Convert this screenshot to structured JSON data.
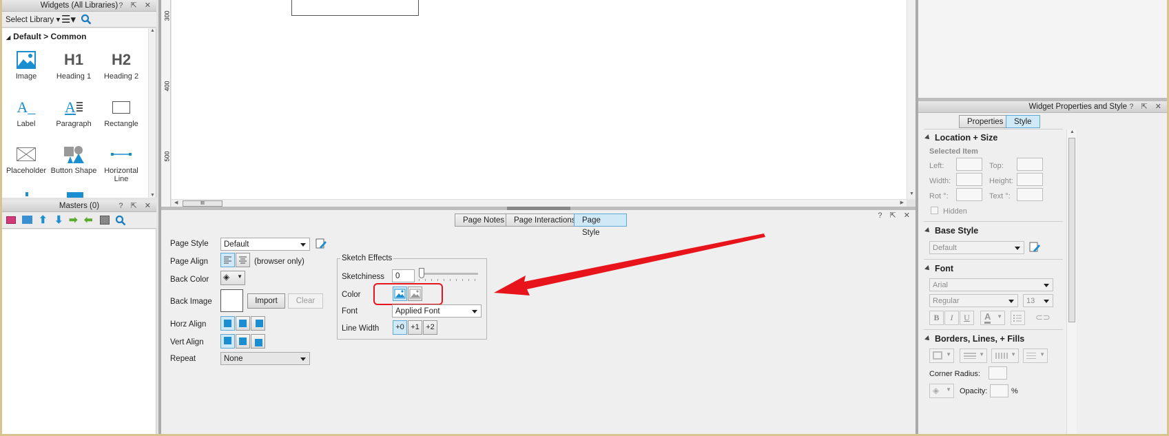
{
  "widgets_panel": {
    "title": "Widgets (All Libraries)",
    "select_library": "Select Library",
    "group": "Default > Common",
    "items": [
      {
        "label": "Image",
        "icon": "image-icon"
      },
      {
        "label": "Heading 1",
        "icon_text": "H1"
      },
      {
        "label": "Heading 2",
        "icon_text": "H2"
      },
      {
        "label": "Label",
        "icon_text": "A_"
      },
      {
        "label": "Paragraph",
        "icon_text": "A"
      },
      {
        "label": "Rectangle",
        "icon": "rectangle-icon"
      },
      {
        "label": "Placeholder",
        "icon": "placeholder-icon"
      },
      {
        "label": "Button Shape",
        "icon": "button-shape-icon"
      },
      {
        "label": "Horizontal Line",
        "icon": "horizontal-line-icon"
      }
    ]
  },
  "masters_panel": {
    "title": "Masters (0)"
  },
  "canvas": {
    "ruler_ticks": [
      "300",
      "400",
      "500"
    ],
    "scroll_thumb": "III"
  },
  "page_panel": {
    "tabs": [
      "Page Notes",
      "Page Interactions",
      "Page Style"
    ],
    "active_tab": "Page Style",
    "page_style_label": "Page Style",
    "page_style_value": "Default",
    "page_align_label": "Page Align",
    "browser_only": "(browser only)",
    "back_color_label": "Back Color",
    "back_image_label": "Back Image",
    "import_label": "Import",
    "clear_label": "Clear",
    "horz_align_label": "Horz Align",
    "vert_align_label": "Vert Align",
    "repeat_label": "Repeat",
    "repeat_value": "None",
    "sketch": {
      "title": "Sketch Effects",
      "sketchiness_label": "Sketchiness",
      "sketchiness_value": "0",
      "sketchiness_level": 0,
      "color_label": "Color",
      "font_label": "Font",
      "font_value": "Applied Font",
      "line_width_label": "Line Width",
      "line_widths": [
        "+0",
        "+1",
        "+2"
      ]
    }
  },
  "props_panel": {
    "title": "Widget Properties and Style",
    "tabs": [
      "Properties",
      "Style"
    ],
    "active_tab": "Style",
    "location_size": "Location + Size",
    "selected_item": "Selected Item",
    "left": "Left:",
    "top": "Top:",
    "width": "Width:",
    "height": "Height:",
    "rot": "Rot °:",
    "text_rot": "Text °:",
    "hidden": "Hidden",
    "base_style": "Base Style",
    "base_style_value": "Default",
    "font": "Font",
    "font_family": "Arial",
    "font_weight": "Regular",
    "font_size": "13",
    "bold": "B",
    "italic": "I",
    "underline": "U",
    "font_color_glyph": "A",
    "borders": "Borders, Lines, + Fills",
    "corner_radius": "Corner Radius:",
    "opacity": "Opacity:",
    "percent": "%"
  },
  "colors": {
    "accent": "#1a8ed1",
    "arrow": "#e8141b",
    "active_tab": "#cfe9f7"
  }
}
